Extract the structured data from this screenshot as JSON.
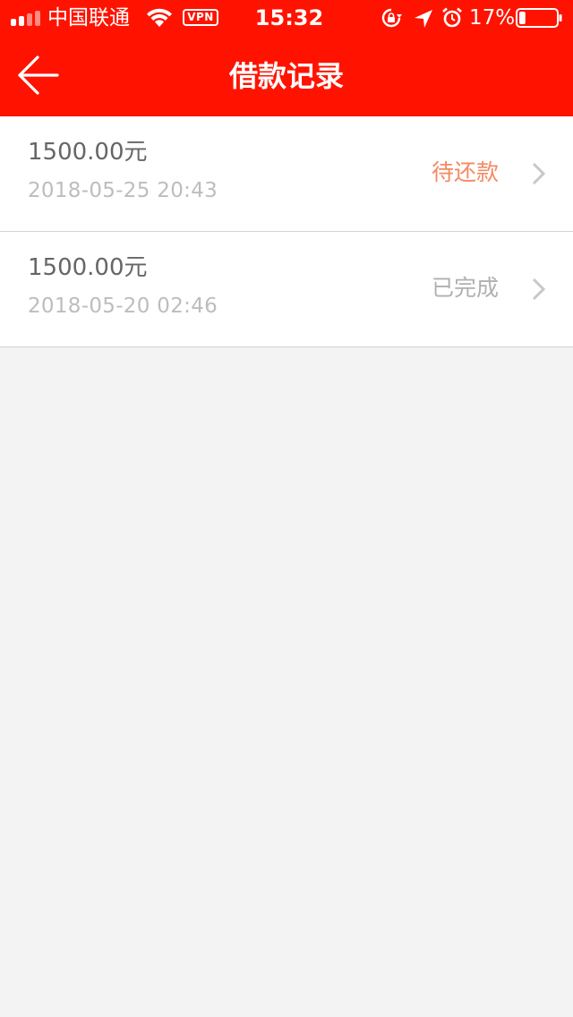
{
  "status_bar": {
    "carrier": "中国联通",
    "vpn": "VPN",
    "time": "15:32",
    "battery_percent": "17%",
    "icons": [
      "signal-icon",
      "wifi-icon",
      "orientation-lock-icon",
      "location-icon",
      "alarm-icon",
      "battery-icon"
    ],
    "battery_level": 0.17
  },
  "nav": {
    "title": "借款记录",
    "back_icon": "arrow-left-icon"
  },
  "loans": [
    {
      "amount": "1500.00元",
      "datetime": "2018-05-25 20:43",
      "status": "待还款",
      "status_color": "#f38a62"
    },
    {
      "amount": "1500.00元",
      "datetime": "2018-05-20 02:46",
      "status": "已完成",
      "status_color": "#b0b0b0"
    }
  ],
  "colors": {
    "header": "#ff1300",
    "background": "#f3f3f3",
    "pending": "#f38a62",
    "completed": "#b0b0b0"
  }
}
